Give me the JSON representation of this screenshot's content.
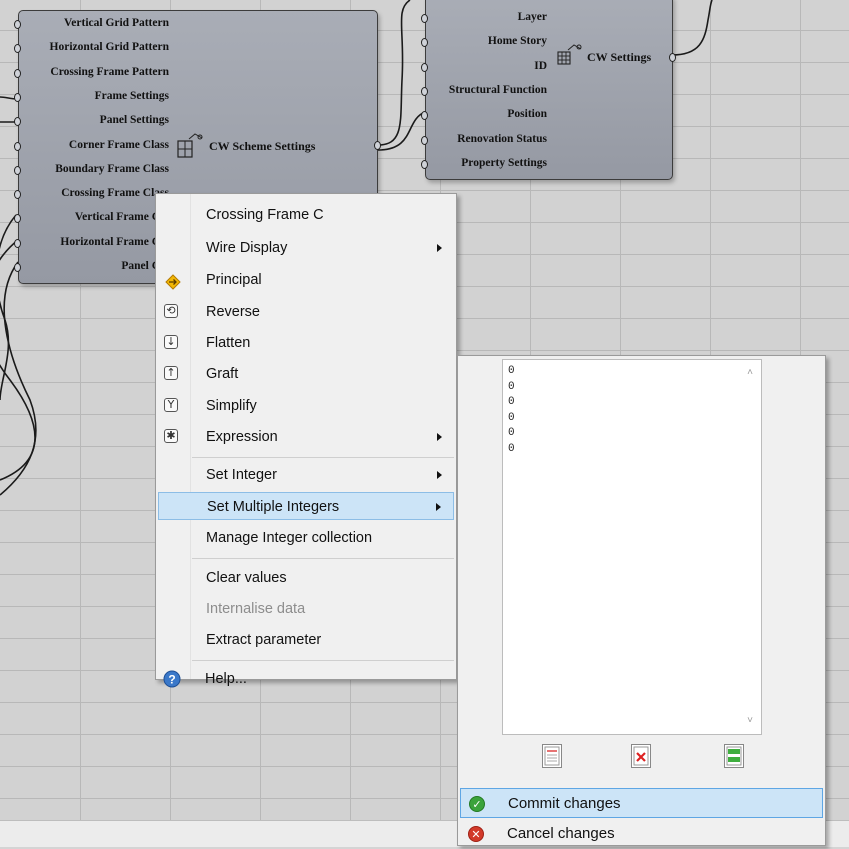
{
  "scheme_component": {
    "inputs": [
      "Vertical Grid Pattern",
      "Horizontal Grid Pattern",
      "Crossing Frame Pattern",
      "Frame Settings",
      "Panel Settings",
      "Corner Frame Class",
      "Boundary Frame Class",
      "Crossing Frame Class",
      "Vertical Frame Cla",
      "Horizontal Frame Cla",
      "Panel Cla"
    ],
    "output": "CW Scheme Settings",
    "icon": "curtain-wall-scheme-icon"
  },
  "settings_component": {
    "inputs": [
      "Layer",
      "Home Story",
      "ID",
      "Structural Function",
      "Position",
      "Renovation Status",
      "Property Settings"
    ],
    "output": "CW Settings",
    "icon": "curtain-wall-icon"
  },
  "context_menu": {
    "title": "Crossing Frame C",
    "items": [
      {
        "label": "Wire Display",
        "submenu": true
      },
      {
        "label": "Principal",
        "icon": "principal-icon"
      },
      {
        "label": "Reverse",
        "icon": "reverse-icon"
      },
      {
        "label": "Flatten",
        "icon": "flatten-icon"
      },
      {
        "label": "Graft",
        "icon": "graft-icon"
      },
      {
        "label": "Simplify",
        "icon": "simplify-icon"
      },
      {
        "label": "Expression",
        "icon": "expression-icon",
        "submenu": true
      },
      {
        "label": "Set Integer",
        "submenu": true
      },
      {
        "label": "Set Multiple Integers",
        "submenu": true,
        "highlighted": true
      },
      {
        "label": "Manage Integer collection"
      },
      {
        "label": "Clear values"
      },
      {
        "label": "Internalise data",
        "disabled": true
      },
      {
        "label": "Extract parameter"
      },
      {
        "label": "Help...",
        "icon": "help-icon"
      }
    ]
  },
  "submenu": {
    "values": [
      "0",
      "0",
      "0",
      "0",
      "0",
      "0"
    ],
    "commit_label": "Commit changes",
    "cancel_label": "Cancel changes"
  },
  "colors": {
    "menu_highlight": "#cce4f7",
    "component_fill": "#9ea2ac",
    "commit_green": "#3ba33b",
    "cancel_red": "#d23a2a"
  }
}
